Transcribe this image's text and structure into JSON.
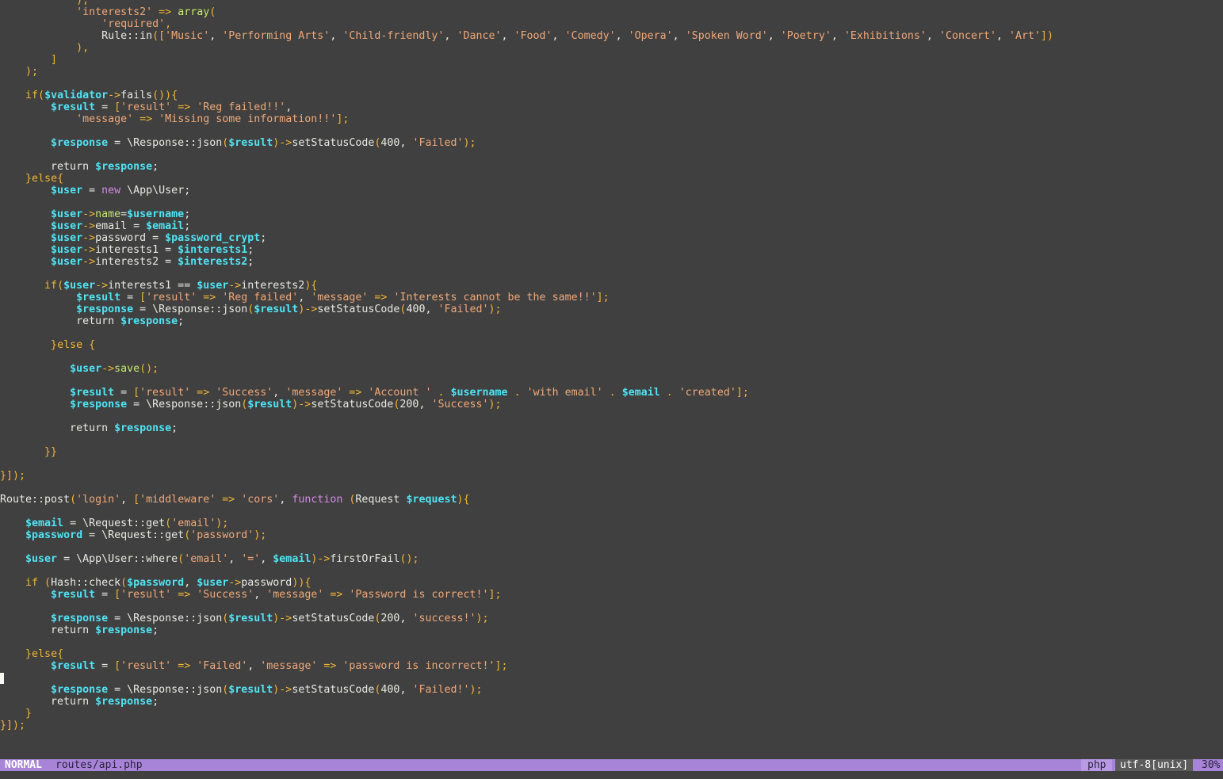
{
  "editor": {
    "lines": [
      [
        [
          "            ),",
          "o"
        ]
      ],
      [
        [
          "            ",
          "p"
        ],
        [
          "'interests2'",
          "s"
        ],
        [
          " => ",
          "o"
        ],
        [
          "array",
          "g"
        ],
        [
          "(",
          "o"
        ]
      ],
      [
        [
          "                ",
          "p"
        ],
        [
          "'required'",
          "s"
        ],
        [
          ",",
          "o"
        ]
      ],
      [
        [
          "                Rule::in",
          "p"
        ],
        [
          "([",
          "o"
        ],
        [
          "'Music'",
          "s"
        ],
        [
          ", ",
          "p"
        ],
        [
          "'Performing Arts'",
          "s"
        ],
        [
          ", ",
          "p"
        ],
        [
          "'Child-friendly'",
          "s"
        ],
        [
          ", ",
          "p"
        ],
        [
          "'Dance'",
          "s"
        ],
        [
          ", ",
          "p"
        ],
        [
          "'Food'",
          "s"
        ],
        [
          ", ",
          "p"
        ],
        [
          "'Comedy'",
          "s"
        ],
        [
          ", ",
          "p"
        ],
        [
          "'Opera'",
          "s"
        ],
        [
          ", ",
          "p"
        ],
        [
          "'Spoken Word'",
          "s"
        ],
        [
          ", ",
          "p"
        ],
        [
          "'Poetry'",
          "s"
        ],
        [
          ", ",
          "p"
        ],
        [
          "'Exhibitions'",
          "s"
        ],
        [
          ", ",
          "p"
        ],
        [
          "'Concert'",
          "s"
        ],
        [
          ", ",
          "p"
        ],
        [
          "'Art'",
          "s"
        ],
        [
          "])",
          "o"
        ]
      ],
      [
        [
          "            ),",
          "o"
        ]
      ],
      [
        [
          "        ]",
          "o"
        ]
      ],
      [
        [
          "    );",
          "o"
        ]
      ],
      [
        [
          "",
          "p"
        ]
      ],
      [
        [
          "    ",
          "p"
        ],
        [
          "if",
          "k"
        ],
        [
          "(",
          "o"
        ],
        [
          "$validator",
          "v"
        ],
        [
          "->",
          "o"
        ],
        [
          "fails",
          "p"
        ],
        [
          "()){",
          "o"
        ]
      ],
      [
        [
          "        ",
          "p"
        ],
        [
          "$result",
          "v"
        ],
        [
          " = ",
          "p"
        ],
        [
          "[",
          "o"
        ],
        [
          "'result'",
          "s"
        ],
        [
          " => ",
          "o"
        ],
        [
          "'Reg failed!!'",
          "s"
        ],
        [
          ",",
          "p"
        ]
      ],
      [
        [
          "            ",
          "p"
        ],
        [
          "'message'",
          "s"
        ],
        [
          " => ",
          "o"
        ],
        [
          "'Missing some information!!'",
          "s"
        ],
        [
          "];",
          "o"
        ]
      ],
      [
        [
          "",
          "p"
        ]
      ],
      [
        [
          "        ",
          "p"
        ],
        [
          "$response",
          "v"
        ],
        [
          " = \\Response::json",
          "p"
        ],
        [
          "(",
          "o"
        ],
        [
          "$result",
          "v"
        ],
        [
          ")->",
          "o"
        ],
        [
          "setStatusCode",
          "p"
        ],
        [
          "(",
          "o"
        ],
        [
          "400",
          "p"
        ],
        [
          ", ",
          "p"
        ],
        [
          "'Failed'",
          "s"
        ],
        [
          ");",
          "o"
        ]
      ],
      [
        [
          "",
          "p"
        ]
      ],
      [
        [
          "        return ",
          "p"
        ],
        [
          "$response",
          "v"
        ],
        [
          ";",
          "p"
        ]
      ],
      [
        [
          "    ",
          "p"
        ],
        [
          "}",
          "o"
        ],
        [
          "else",
          "k"
        ],
        [
          "{",
          "o"
        ]
      ],
      [
        [
          "        ",
          "p"
        ],
        [
          "$user",
          "v"
        ],
        [
          " = ",
          "p"
        ],
        [
          "new",
          "m"
        ],
        [
          " \\App\\User;",
          "p"
        ]
      ],
      [
        [
          "",
          "p"
        ]
      ],
      [
        [
          "        ",
          "p"
        ],
        [
          "$user",
          "v"
        ],
        [
          "->",
          "o"
        ],
        [
          "name",
          "g"
        ],
        [
          "=",
          "p"
        ],
        [
          "$username",
          "v"
        ],
        [
          ";",
          "p"
        ]
      ],
      [
        [
          "        ",
          "p"
        ],
        [
          "$user",
          "v"
        ],
        [
          "->",
          "o"
        ],
        [
          "email = ",
          "p"
        ],
        [
          "$email",
          "v"
        ],
        [
          ";",
          "p"
        ]
      ],
      [
        [
          "        ",
          "p"
        ],
        [
          "$user",
          "v"
        ],
        [
          "->",
          "o"
        ],
        [
          "password = ",
          "p"
        ],
        [
          "$password_crypt",
          "v"
        ],
        [
          ";",
          "p"
        ]
      ],
      [
        [
          "        ",
          "p"
        ],
        [
          "$user",
          "v"
        ],
        [
          "->",
          "o"
        ],
        [
          "interests1 = ",
          "p"
        ],
        [
          "$interests1",
          "v"
        ],
        [
          ";",
          "p"
        ]
      ],
      [
        [
          "        ",
          "p"
        ],
        [
          "$user",
          "v"
        ],
        [
          "->",
          "o"
        ],
        [
          "interests2 = ",
          "p"
        ],
        [
          "$interests2",
          "v"
        ],
        [
          ";",
          "p"
        ]
      ],
      [
        [
          "",
          "p"
        ]
      ],
      [
        [
          "       ",
          "p"
        ],
        [
          "if",
          "k"
        ],
        [
          "(",
          "o"
        ],
        [
          "$user",
          "v"
        ],
        [
          "->",
          "o"
        ],
        [
          "interests1 == ",
          "p"
        ],
        [
          "$user",
          "v"
        ],
        [
          "->",
          "o"
        ],
        [
          "interests2",
          "p"
        ],
        [
          "){",
          "o"
        ]
      ],
      [
        [
          "            ",
          "p"
        ],
        [
          "$result",
          "v"
        ],
        [
          " = ",
          "p"
        ],
        [
          "[",
          "o"
        ],
        [
          "'result'",
          "s"
        ],
        [
          " => ",
          "o"
        ],
        [
          "'Reg failed'",
          "s"
        ],
        [
          ", ",
          "p"
        ],
        [
          "'message'",
          "s"
        ],
        [
          " => ",
          "o"
        ],
        [
          "'Interests cannot be the same!!'",
          "s"
        ],
        [
          "];",
          "o"
        ]
      ],
      [
        [
          "            ",
          "p"
        ],
        [
          "$response",
          "v"
        ],
        [
          " = \\Response::json",
          "p"
        ],
        [
          "(",
          "o"
        ],
        [
          "$result",
          "v"
        ],
        [
          ")->",
          "o"
        ],
        [
          "setStatusCode",
          "p"
        ],
        [
          "(",
          "o"
        ],
        [
          "400",
          "p"
        ],
        [
          ", ",
          "p"
        ],
        [
          "'Failed'",
          "s"
        ],
        [
          ");",
          "o"
        ]
      ],
      [
        [
          "            return ",
          "p"
        ],
        [
          "$response",
          "v"
        ],
        [
          ";",
          "p"
        ]
      ],
      [
        [
          "",
          "p"
        ]
      ],
      [
        [
          "        ",
          "p"
        ],
        [
          "}",
          "o"
        ],
        [
          "else",
          "k"
        ],
        [
          " {",
          "o"
        ]
      ],
      [
        [
          "",
          "p"
        ]
      ],
      [
        [
          "           ",
          "p"
        ],
        [
          "$user",
          "v"
        ],
        [
          "->",
          "o"
        ],
        [
          "save",
          "g"
        ],
        [
          "();",
          "o"
        ]
      ],
      [
        [
          "",
          "p"
        ]
      ],
      [
        [
          "           ",
          "p"
        ],
        [
          "$result",
          "v"
        ],
        [
          " = ",
          "p"
        ],
        [
          "[",
          "o"
        ],
        [
          "'result'",
          "s"
        ],
        [
          " => ",
          "o"
        ],
        [
          "'Success'",
          "s"
        ],
        [
          ", ",
          "p"
        ],
        [
          "'message'",
          "s"
        ],
        [
          " => ",
          "o"
        ],
        [
          "'Account '",
          "s"
        ],
        [
          " . ",
          "o"
        ],
        [
          "$username",
          "v"
        ],
        [
          " . ",
          "o"
        ],
        [
          "'with email'",
          "s"
        ],
        [
          " . ",
          "o"
        ],
        [
          "$email",
          "v"
        ],
        [
          " . ",
          "o"
        ],
        [
          "'created'",
          "s"
        ],
        [
          "];",
          "o"
        ]
      ],
      [
        [
          "           ",
          "p"
        ],
        [
          "$response",
          "v"
        ],
        [
          " = \\Response::json",
          "p"
        ],
        [
          "(",
          "o"
        ],
        [
          "$result",
          "v"
        ],
        [
          ")->",
          "o"
        ],
        [
          "setStatusCode",
          "p"
        ],
        [
          "(",
          "o"
        ],
        [
          "200",
          "p"
        ],
        [
          ", ",
          "p"
        ],
        [
          "'Success'",
          "s"
        ],
        [
          ");",
          "o"
        ]
      ],
      [
        [
          "",
          "p"
        ]
      ],
      [
        [
          "           return ",
          "p"
        ],
        [
          "$response",
          "v"
        ],
        [
          ";",
          "p"
        ]
      ],
      [
        [
          "",
          "p"
        ]
      ],
      [
        [
          "       ",
          "p"
        ],
        [
          "}}",
          "o"
        ]
      ],
      [
        [
          "",
          "p"
        ]
      ],
      [
        [
          "}]);",
          "o"
        ]
      ],
      [
        [
          "",
          "p"
        ]
      ],
      [
        [
          "Route::post",
          "p"
        ],
        [
          "(",
          "o"
        ],
        [
          "'login'",
          "s"
        ],
        [
          ", ",
          "p"
        ],
        [
          "[",
          "o"
        ],
        [
          "'middleware'",
          "s"
        ],
        [
          " => ",
          "o"
        ],
        [
          "'cors'",
          "s"
        ],
        [
          ", ",
          "p"
        ],
        [
          "function",
          "m"
        ],
        [
          " (",
          "o"
        ],
        [
          "Request ",
          "p"
        ],
        [
          "$request",
          "v"
        ],
        [
          "){",
          "o"
        ]
      ],
      [
        [
          "",
          "p"
        ]
      ],
      [
        [
          "    ",
          "p"
        ],
        [
          "$email",
          "v"
        ],
        [
          " = \\Request::get",
          "p"
        ],
        [
          "(",
          "o"
        ],
        [
          "'email'",
          "s"
        ],
        [
          ");",
          "o"
        ]
      ],
      [
        [
          "    ",
          "p"
        ],
        [
          "$password",
          "v"
        ],
        [
          " = \\Request::get",
          "p"
        ],
        [
          "(",
          "o"
        ],
        [
          "'password'",
          "s"
        ],
        [
          ");",
          "o"
        ]
      ],
      [
        [
          "",
          "p"
        ]
      ],
      [
        [
          "    ",
          "p"
        ],
        [
          "$user",
          "v"
        ],
        [
          " = \\App\\User::where",
          "p"
        ],
        [
          "(",
          "o"
        ],
        [
          "'email'",
          "s"
        ],
        [
          ", ",
          "p"
        ],
        [
          "'='",
          "s"
        ],
        [
          ", ",
          "p"
        ],
        [
          "$email",
          "v"
        ],
        [
          ")->",
          "o"
        ],
        [
          "firstOrFail",
          "p"
        ],
        [
          "();",
          "o"
        ]
      ],
      [
        [
          "",
          "p"
        ]
      ],
      [
        [
          "    ",
          "p"
        ],
        [
          "if",
          "k"
        ],
        [
          " (",
          "o"
        ],
        [
          "Hash::check",
          "p"
        ],
        [
          "(",
          "o"
        ],
        [
          "$password",
          "v"
        ],
        [
          ", ",
          "p"
        ],
        [
          "$user",
          "v"
        ],
        [
          "->",
          "o"
        ],
        [
          "password",
          "p"
        ],
        [
          ")){",
          "o"
        ]
      ],
      [
        [
          "        ",
          "p"
        ],
        [
          "$result",
          "v"
        ],
        [
          " = ",
          "p"
        ],
        [
          "[",
          "o"
        ],
        [
          "'result'",
          "s"
        ],
        [
          " => ",
          "o"
        ],
        [
          "'Success'",
          "s"
        ],
        [
          ", ",
          "p"
        ],
        [
          "'message'",
          "s"
        ],
        [
          " => ",
          "o"
        ],
        [
          "'Password is correct!'",
          "s"
        ],
        [
          "];",
          "o"
        ]
      ],
      [
        [
          "",
          "p"
        ]
      ],
      [
        [
          "        ",
          "p"
        ],
        [
          "$response",
          "v"
        ],
        [
          " = \\Response::json",
          "p"
        ],
        [
          "(",
          "o"
        ],
        [
          "$result",
          "v"
        ],
        [
          ")->",
          "o"
        ],
        [
          "setStatusCode",
          "p"
        ],
        [
          "(",
          "o"
        ],
        [
          "200",
          "p"
        ],
        [
          ", ",
          "p"
        ],
        [
          "'success!'",
          "s"
        ],
        [
          ");",
          "o"
        ]
      ],
      [
        [
          "        return ",
          "p"
        ],
        [
          "$response",
          "v"
        ],
        [
          ";",
          "p"
        ]
      ],
      [
        [
          "",
          "p"
        ]
      ],
      [
        [
          "    ",
          "p"
        ],
        [
          "}",
          "o"
        ],
        [
          "else",
          "k"
        ],
        [
          "{",
          "o"
        ]
      ],
      [
        [
          "        ",
          "p"
        ],
        [
          "$result",
          "v"
        ],
        [
          " = ",
          "p"
        ],
        [
          "[",
          "o"
        ],
        [
          "'result'",
          "s"
        ],
        [
          " => ",
          "o"
        ],
        [
          "'Failed'",
          "s"
        ],
        [
          ", ",
          "p"
        ],
        [
          "'message'",
          "s"
        ],
        [
          " => ",
          "o"
        ],
        [
          "'password is incorrect!'",
          "s"
        ],
        [
          "];",
          "o"
        ]
      ],
      [
        [
          "",
          "p"
        ]
      ],
      [
        [
          "        ",
          "p"
        ],
        [
          "$response",
          "v"
        ],
        [
          " = \\Response::json",
          "p"
        ],
        [
          "(",
          "o"
        ],
        [
          "$result",
          "v"
        ],
        [
          ")->",
          "o"
        ],
        [
          "setStatusCode",
          "p"
        ],
        [
          "(",
          "o"
        ],
        [
          "400",
          "p"
        ],
        [
          ", ",
          "p"
        ],
        [
          "'Failed!'",
          "s"
        ],
        [
          ");",
          "o"
        ]
      ],
      [
        [
          "        return ",
          "p"
        ],
        [
          "$response",
          "v"
        ],
        [
          ";",
          "p"
        ]
      ],
      [
        [
          "    }",
          "o"
        ]
      ],
      [
        [
          "}]);",
          "o"
        ]
      ]
    ],
    "cursor_line": 57
  },
  "statusline": {
    "mode": "NORMAL",
    "filename": "routes/api.php",
    "filetype": "php",
    "encoding": "utf-8[unix]",
    "percent": "30%"
  },
  "colors": {
    "background": "#404040",
    "statusline": "#a784d8",
    "string": "#f0a878",
    "variable": "#4ee4f4",
    "operator": "#f0b434",
    "function": "#c6e86e",
    "keyword_magenta": "#d48ae8"
  }
}
